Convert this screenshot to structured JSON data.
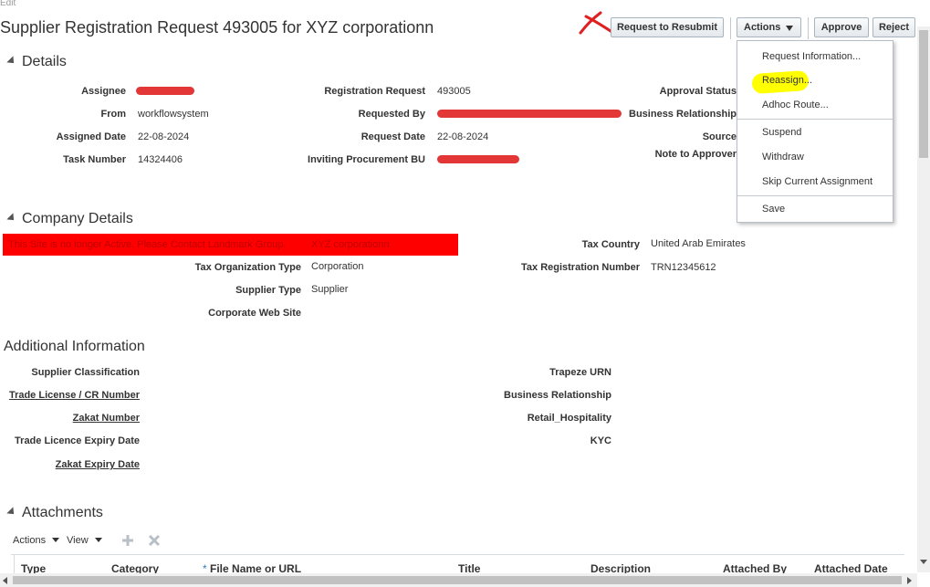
{
  "top": {
    "edit_label": "Edit",
    "title": "Supplier Registration Request 493005 for XYZ corporationn"
  },
  "toolbar": {
    "resubmit_label": "Request to Resubmit",
    "actions_label": "Actions",
    "approve_label": "Approve",
    "reject_label": "Reject"
  },
  "actions_menu": {
    "items": [
      "Request Information...",
      "Reassign...",
      "Adhoc Route...",
      "Suspend",
      "Withdraw",
      "Skip Current Assignment",
      "Save"
    ]
  },
  "details": {
    "heading": "Details",
    "assignee_label": "Assignee",
    "from_label": "From",
    "from_value": "workflowsystem",
    "assigned_date_label": "Assigned Date",
    "assigned_date_value": "22-08-2024",
    "task_number_label": "Task Number",
    "task_number_value": "14324406",
    "registration_request_label": "Registration Request",
    "registration_request_value": "493005",
    "requested_by_label": "Requested By",
    "request_date_label": "Request Date",
    "request_date_value": "22-08-2024",
    "inviting_bu_label": "Inviting Procurement BU",
    "approval_status_label": "Approval Status",
    "business_relationship_label": "Business Relationship",
    "source_label": "Source",
    "note_to_approver_label": "Note to Approver"
  },
  "company": {
    "heading": "Company Details",
    "banner_text": "This Site is no longer Active. Please Contact Landmark Group.",
    "company_name": "XYZ corporationn",
    "tax_org_type_label": "Tax Organization Type",
    "tax_org_type_value": "Corporation",
    "supplier_type_label": "Supplier Type",
    "supplier_type_value": "Supplier",
    "corporate_web_site_label": "Corporate Web Site",
    "tax_country_label": "Tax Country",
    "tax_country_value": "United Arab Emirates",
    "tax_reg_number_label": "Tax Registration Number",
    "tax_reg_number_value": "TRN12345612"
  },
  "additional": {
    "heading": "Additional Information",
    "supplier_classification_label": "Supplier Classification",
    "trade_license_label": "Trade License / CR Number",
    "zakat_number_label": "Zakat Number",
    "trade_licence_expiry_label": "Trade Licence Expiry Date",
    "zakat_expiry_label": "Zakat Expiry Date",
    "trapeze_urn_label": "Trapeze URN",
    "business_relationship_label": "Business Relationship",
    "retail_hospitality_label": "Retail_Hospitality",
    "kyc_label": "KYC"
  },
  "attachments": {
    "heading": "Attachments",
    "actions_label": "Actions",
    "view_label": "View",
    "columns": [
      "Type",
      "Category",
      "File Name or URL",
      "Title",
      "Description",
      "Attached By",
      "Attached Date"
    ],
    "required_marker": "*"
  },
  "colors": {
    "banner_red": "#ff0000",
    "highlight_yellow": "#ffff00",
    "scribble_red": "#e02020"
  }
}
